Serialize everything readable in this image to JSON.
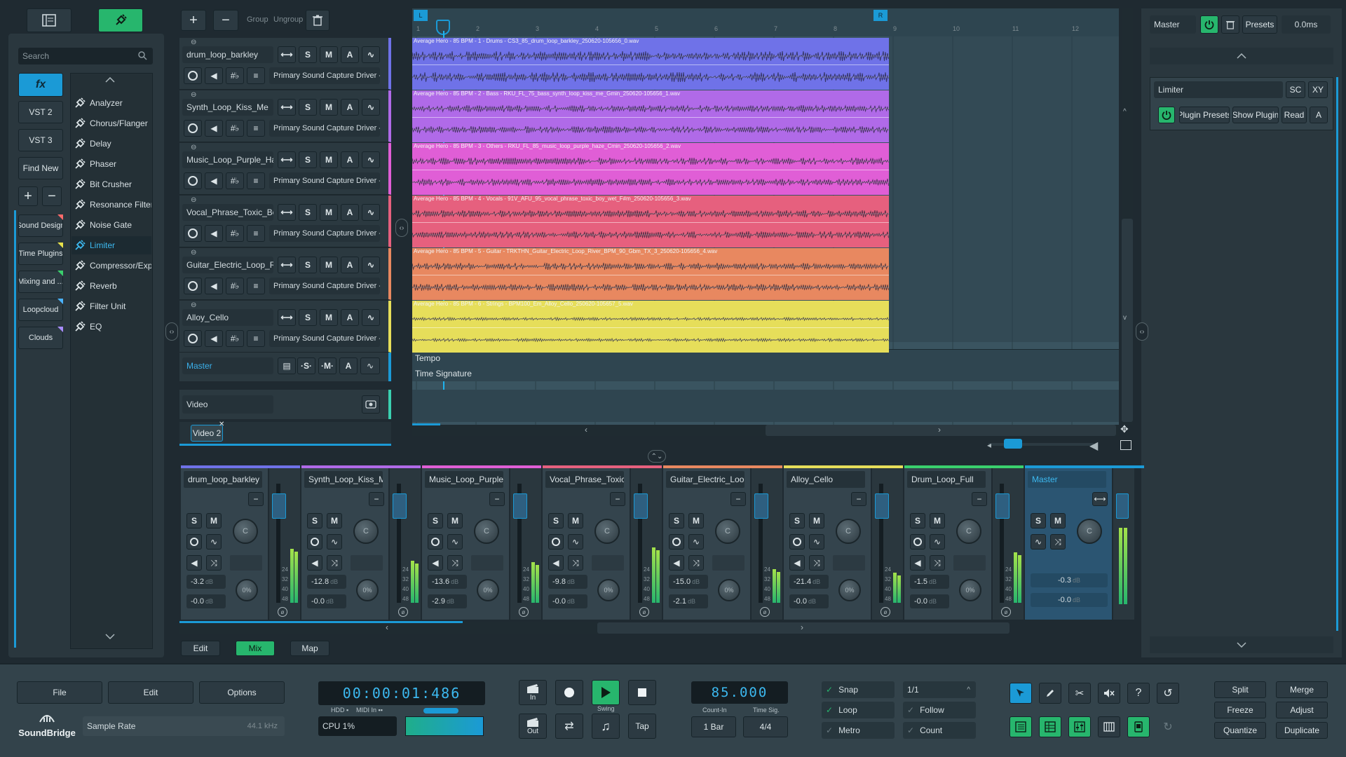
{
  "top_left": {
    "grid_icon": "list-icon",
    "plug_icon": "plug-icon"
  },
  "browser": {
    "search_placeholder": "Search",
    "categories": [
      {
        "label": "fx"
      },
      {
        "label": "VST 2"
      },
      {
        "label": "VST 3"
      },
      {
        "label": "Find New"
      }
    ],
    "collections": [
      {
        "label": "Sound Design",
        "color": "#ff6b6b"
      },
      {
        "label": "Time Plugins",
        "color": "#e8e14a"
      },
      {
        "label": "Mixing and ...",
        "color": "#3ad06d"
      },
      {
        "label": "Loopcloud",
        "color": "#4ab3ff"
      },
      {
        "label": "Clouds",
        "color": "#a88cff"
      }
    ],
    "plugins": [
      "Analyzer",
      "Chorus/Flanger",
      "Delay",
      "Phaser",
      "Bit Crusher",
      "Resonance Filter",
      "Noise Gate",
      "Limiter",
      "Compressor/Expander",
      "Reverb",
      "Filter Unit",
      "EQ"
    ],
    "selected_plugin": "Limiter"
  },
  "track_toolbar": {
    "group": "Group",
    "ungroup": "Ungroup"
  },
  "tracks": [
    {
      "name": "drum_loop_barkley",
      "input": "Primary Sound Capture Driver -",
      "color": "#6f72e8",
      "clip_label": "Average Hero - 85 BPM - 1 - Drums - CS3_85_drum_loop_barkley_250620-105656_0.wav"
    },
    {
      "name": "Synth_Loop_Kiss_Me",
      "input": "Primary Sound Capture Driver -",
      "color": "#b06ae8",
      "clip_label": "Average Hero - 85 BPM - 2 - Bass - RKU_FL_75_bass_synth_loop_kiss_me_Gmin_250620-105656_1.wav"
    },
    {
      "name": "Music_Loop_Purple_Haze",
      "input": "Primary Sound Capture Driver -",
      "color": "#e05ed6",
      "clip_label": "Average Hero - 85 BPM - 3 - Others - RKU_FL_85_music_loop_purple_haze_Cmin_250620-105656_2.wav"
    },
    {
      "name": "Vocal_Phrase_Toxic_Boy",
      "input": "Primary Sound Capture Driver -",
      "color": "#e6607e",
      "clip_label": "Average Hero - 85 BPM - 4 - Vocals - 91V_AFU_95_vocal_phrase_toxic_boy_wet_F#m_250620-105656_3.wav"
    },
    {
      "name": "Guitar_Electric_Loop_River",
      "input": "Primary Sound Capture Driver -",
      "color": "#e88860",
      "clip_label": "Average Hero - 85 BPM - 5 - Guitar - TRKTHN_Guitar_Electric_Loop_River_BPM_90_Gbm_TX_3_250620-105656_4.wav"
    },
    {
      "name": "Alloy_Cello",
      "input": "Primary Sound Capture Driver -",
      "color": "#e6de5a",
      "clip_label": "Average Hero - 85 BPM - 6 - Strings - BPM100_Em_Alloy_Cello_250620-105657_5.wav"
    }
  ],
  "master_track": {
    "name": "Master"
  },
  "video_track": {
    "name": "Video",
    "clip": "Video 2"
  },
  "arrange": {
    "tempo": "Tempo",
    "time_signature": "Time Signature",
    "ruler": [
      "1",
      "2",
      "3",
      "4",
      "5",
      "6",
      "7",
      "8",
      "9",
      "10",
      "11",
      "12"
    ]
  },
  "right_panel": {
    "master": "Master",
    "presets": "Presets",
    "delay": "0.0ms",
    "plugin": "Limiter",
    "sc": "SC",
    "xy": "XY",
    "plugin_presets": "Plugin Presets",
    "show_plugin": "Show Plugin",
    "read": "Read",
    "a": "A"
  },
  "mixer": {
    "channels": [
      {
        "name": "drum_loop_barkley",
        "vol": "-3.2",
        "pan": "-0.0",
        "color": "#6f72e8",
        "level": 0.64
      },
      {
        "name": "Synth_Loop_Kiss_Me",
        "vol": "-12.8",
        "pan": "-0.0",
        "color": "#b06ae8",
        "level": 0.5
      },
      {
        "name": "Music_Loop_Purple_Haze",
        "vol": "-13.6",
        "pan": "-2.9",
        "color": "#e05ed6",
        "level": 0.48
      },
      {
        "name": "Vocal_Phrase_Toxic_Boy",
        "vol": "-9.8",
        "pan": "-0.0",
        "color": "#e6607e",
        "level": 0.66
      },
      {
        "name": "Guitar_Electric_Loop_Ri...",
        "vol": "-15.0",
        "pan": "-2.1",
        "color": "#e88860",
        "level": 0.4
      },
      {
        "name": "Alloy_Cello",
        "vol": "-21.4",
        "pan": "-0.0",
        "color": "#e6de5a",
        "level": 0.36
      },
      {
        "name": "Drum_Loop_Full",
        "vol": "-1.5",
        "pan": "-0.0",
        "color": "#3ad06d",
        "level": 0.6
      }
    ],
    "master": {
      "name": "Master",
      "vol": "-0.3",
      "pan": "-0.0",
      "level": 0.78
    },
    "db": "dB",
    "scale": [
      "24",
      "32",
      "40",
      "48"
    ],
    "tabs": [
      "Edit",
      "Mix",
      "Map"
    ],
    "active_tab": "Mix"
  },
  "transport": {
    "file": "File",
    "edit": "Edit",
    "options": "Options",
    "sample_rate_label": "Sample Rate",
    "sample_rate": "44.1 kHz",
    "time": "00:00:01:486",
    "hdd": "HDD",
    "midi_in": "MIDI In",
    "cpu": "CPU 1%",
    "in": "In",
    "out": "Out",
    "swing": "Swing",
    "tap": "Tap",
    "tempo": "85.000",
    "count_in_label": "Count-In",
    "time_sig_label": "Time Sig.",
    "count_in": "1 Bar",
    "time_sig": "4/4",
    "snap": "Snap",
    "loop": "Loop",
    "metro": "Metro",
    "grid": "1/1",
    "follow": "Follow",
    "count": "Count",
    "split": "Split",
    "merge": "Merge",
    "freeze": "Freeze",
    "adjust": "Adjust",
    "quantize": "Quantize",
    "duplicate": "Duplicate",
    "logo": "SoundBridge"
  }
}
